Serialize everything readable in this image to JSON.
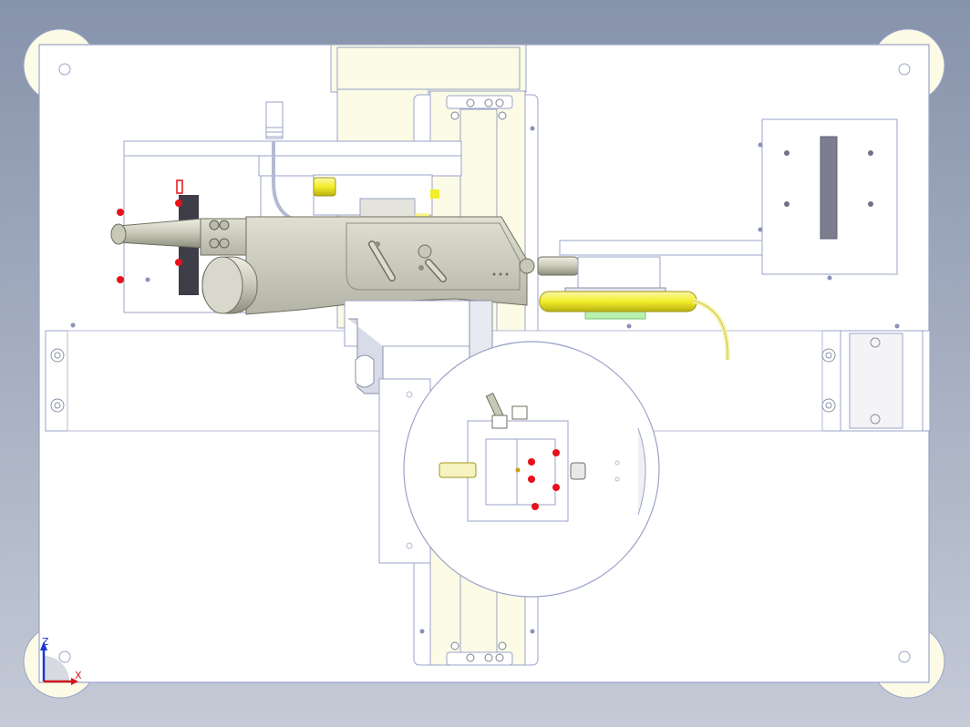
{
  "viewport": {
    "background_top": "#8793ab",
    "background_bottom": "#c4cad6"
  },
  "colors": {
    "plate": "#ffffff",
    "outline": "#9aa3c8",
    "cream": "#fbfbe6",
    "gun_body": "#d2d2c4",
    "gun_dark": "#a4a496",
    "accent_yellow": "#f2ee2a",
    "cable_yellow": "#f6f3a0",
    "green_block": "#b8f0b0",
    "marker_red": "#e8101a",
    "dark_bar": "#3e3e48",
    "axis_z": "#1a3ad0",
    "axis_x": "#d01a1a"
  },
  "triad": {
    "z_label": "Z",
    "x_label": "X"
  }
}
